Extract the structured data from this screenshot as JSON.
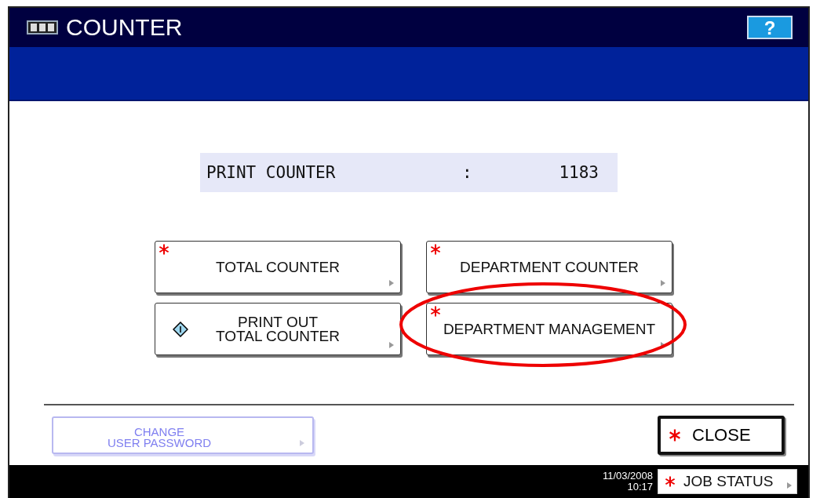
{
  "window": {
    "title": "COUNTER",
    "help": "?"
  },
  "counter": {
    "label": "PRINT COUNTER",
    "separator": ":",
    "value": "1183"
  },
  "buttons": [
    {
      "label": "TOTAL COUNTER",
      "kind": "asterisk",
      "circled": false
    },
    {
      "label": "DEPARTMENT COUNTER",
      "kind": "asterisk",
      "circled": false
    },
    {
      "label": "PRINT OUT\nTOTAL COUNTER",
      "kind": "start",
      "circled": false
    },
    {
      "label": "DEPARTMENT MANAGEMENT",
      "kind": "asterisk",
      "circled": true
    }
  ],
  "change_password": {
    "label": "CHANGE\nUSER PASSWORD",
    "disabled": true
  },
  "close_button": {
    "label": "CLOSE"
  },
  "status_bar": {
    "date": "11/03/2008",
    "time": "10:17",
    "job_status": "JOB STATUS"
  }
}
